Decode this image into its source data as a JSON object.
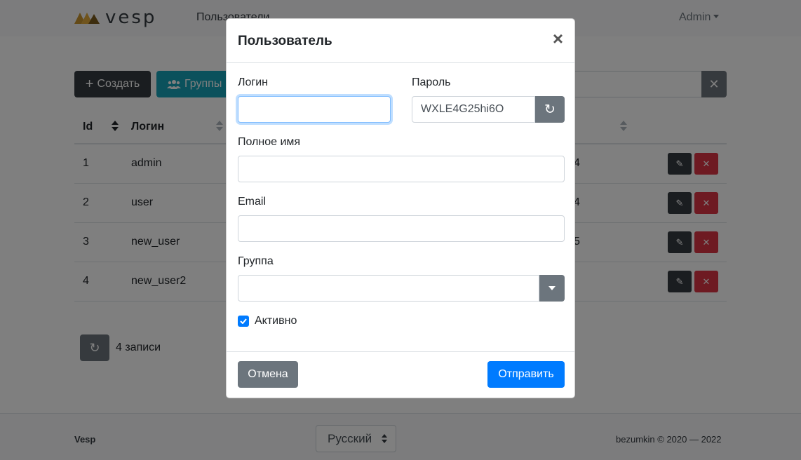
{
  "navbar": {
    "brand": "vesp",
    "link": "Пользователи",
    "user": "Admin"
  },
  "toolbar": {
    "create_label": "Создать",
    "groups_label": "Группы"
  },
  "table": {
    "headers": [
      "Id",
      "Логин"
    ],
    "rows": [
      {
        "id": "1",
        "login": "admin",
        "extra": "4"
      },
      {
        "id": "2",
        "login": "user",
        "extra": "4"
      },
      {
        "id": "3",
        "login": "new_user",
        "extra": "5"
      },
      {
        "id": "4",
        "login": "new_user2",
        "extra": ""
      }
    ]
  },
  "pagination": {
    "records": "4 записи"
  },
  "footer": {
    "brand": "Vesp",
    "language": "Русский",
    "copyright": "bezumkin © 2020 — 2022"
  },
  "modal": {
    "title": "Пользователь",
    "close": "×",
    "login_label": "Логин",
    "login_value": "",
    "password_label": "Пароль",
    "password_value": "WXLE4G25hi6O",
    "fullname_label": "Полное имя",
    "fullname_value": "",
    "email_label": "Email",
    "email_value": "",
    "group_label": "Группа",
    "group_value": "",
    "active_label": "Активно",
    "active_checked": true,
    "cancel_label": "Отмена",
    "submit_label": "Отправить"
  },
  "colors": {
    "primary": "#007bff",
    "dark": "#343a40",
    "info": "#17a2b8",
    "danger": "#dc3545",
    "secondary": "#6c757d"
  }
}
